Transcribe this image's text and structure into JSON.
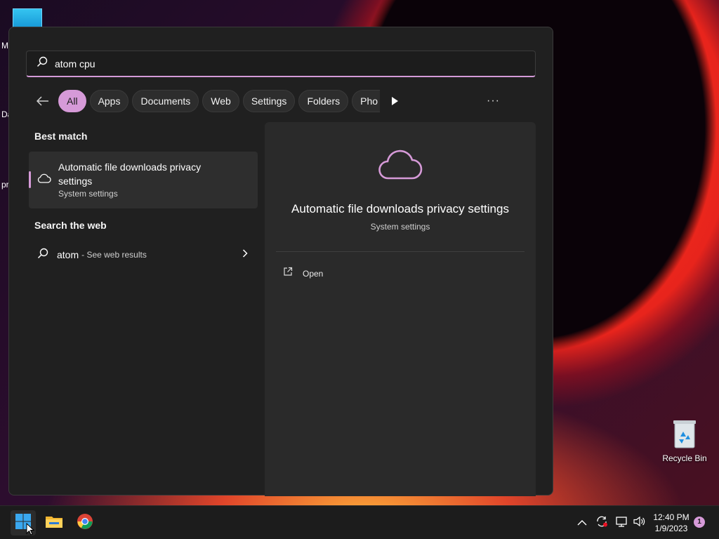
{
  "desktop": {
    "fragments": [
      "M",
      "Da",
      "pr"
    ],
    "recycle_bin_label": "Recycle Bin"
  },
  "search": {
    "query": "atom cpu"
  },
  "filters": {
    "chips": [
      "All",
      "Apps",
      "Documents",
      "Web",
      "Settings",
      "Folders",
      "Pho"
    ],
    "active": "All"
  },
  "results": {
    "best_match_header": "Best match",
    "best_match": {
      "title": "Automatic file downloads privacy settings",
      "subtitle": "System settings"
    },
    "web_header": "Search the web",
    "web_result": {
      "term": "atom",
      "hint": "- See web results"
    }
  },
  "detail": {
    "title": "Automatic file downloads privacy settings",
    "subtitle": "System settings",
    "actions": [
      {
        "label": "Open",
        "icon": "open-external-icon"
      }
    ]
  },
  "taskbar": {
    "apps": [
      "start-icon",
      "file-explorer-icon",
      "chrome-icon"
    ],
    "time": "12:40 PM",
    "date": "1/9/2023",
    "notification_count": "1"
  },
  "colors": {
    "accent": "#d69ad8",
    "panel_bg": "#202020",
    "detail_bg": "#2a2a2a"
  }
}
